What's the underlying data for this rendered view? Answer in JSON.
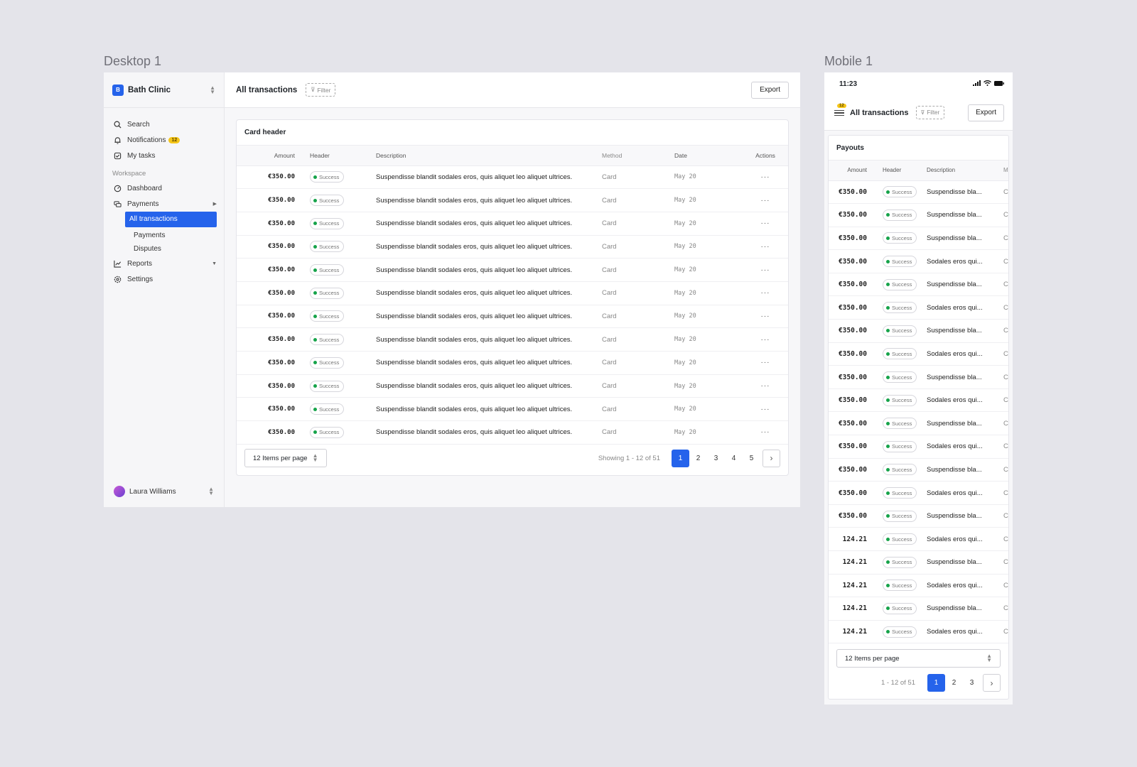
{
  "frames": {
    "desktop_label": "Desktop 1",
    "mobile_label": "Mobile 1"
  },
  "sidebar": {
    "org": {
      "logo_letter": "B",
      "name": "Bath Clinic"
    },
    "top_items": [
      {
        "label": "Search",
        "icon": "search-icon"
      },
      {
        "label": "Notifications",
        "icon": "bell-icon",
        "badge": "12"
      },
      {
        "label": "My tasks",
        "icon": "tasks-icon"
      }
    ],
    "workspace_title": "Workspace",
    "items": [
      {
        "label": "Dashboard",
        "icon": "dashboard-icon"
      },
      {
        "label": "Payments",
        "icon": "payments-icon",
        "arrow": "▶"
      }
    ],
    "payments_sub": [
      {
        "label": "All transactions",
        "active": true
      },
      {
        "label": "Payments",
        "active": false
      },
      {
        "label": "Disputes",
        "active": false
      }
    ],
    "bottom_items": [
      {
        "label": "Reports",
        "icon": "reports-icon",
        "arrow": "▼"
      },
      {
        "label": "Settings",
        "icon": "settings-icon"
      }
    ],
    "user": {
      "name": "Laura Williams"
    }
  },
  "desktop": {
    "title": "All transactions",
    "filter_label": "Filter",
    "export_label": "Export",
    "card_title": "Card header",
    "columns": [
      "Amount",
      "Header",
      "Description",
      "Method",
      "Date",
      "Actions"
    ],
    "rows": [
      {
        "amount": "€350.00",
        "status": "Success",
        "description": "Suspendisse blandit sodales eros, quis aliquet leo aliquet ultrices.",
        "method": "Card",
        "date": "May 20"
      },
      {
        "amount": "€350.00",
        "status": "Success",
        "description": "Suspendisse blandit sodales eros, quis aliquet leo aliquet ultrices.",
        "method": "Card",
        "date": "May 20"
      },
      {
        "amount": "€350.00",
        "status": "Success",
        "description": "Suspendisse blandit sodales eros, quis aliquet leo aliquet ultrices.",
        "method": "Card",
        "date": "May 20"
      },
      {
        "amount": "€350.00",
        "status": "Success",
        "description": "Suspendisse blandit sodales eros, quis aliquet leo aliquet ultrices.",
        "method": "Card",
        "date": "May 20"
      },
      {
        "amount": "€350.00",
        "status": "Success",
        "description": "Suspendisse blandit sodales eros, quis aliquet leo aliquet ultrices.",
        "method": "Card",
        "date": "May 20"
      },
      {
        "amount": "€350.00",
        "status": "Success",
        "description": "Suspendisse blandit sodales eros, quis aliquet leo aliquet ultrices.",
        "method": "Card",
        "date": "May 20"
      },
      {
        "amount": "€350.00",
        "status": "Success",
        "description": "Suspendisse blandit sodales eros, quis aliquet leo aliquet ultrices.",
        "method": "Card",
        "date": "May 20"
      },
      {
        "amount": "€350.00",
        "status": "Success",
        "description": "Suspendisse blandit sodales eros, quis aliquet leo aliquet ultrices.",
        "method": "Card",
        "date": "May 20"
      },
      {
        "amount": "€350.00",
        "status": "Success",
        "description": "Suspendisse blandit sodales eros, quis aliquet leo aliquet ultrices.",
        "method": "Card",
        "date": "May 20"
      },
      {
        "amount": "€350.00",
        "status": "Success",
        "description": "Suspendisse blandit sodales eros, quis aliquet leo aliquet ultrices.",
        "method": "Card",
        "date": "May 20"
      },
      {
        "amount": "€350.00",
        "status": "Success",
        "description": "Suspendisse blandit sodales eros, quis aliquet leo aliquet ultrices.",
        "method": "Card",
        "date": "May 20"
      },
      {
        "amount": "€350.00",
        "status": "Success",
        "description": "Suspendisse blandit sodales eros, quis aliquet leo aliquet ultrices.",
        "method": "Card",
        "date": "May 20"
      }
    ],
    "actions_glyph": "···",
    "pagination": {
      "items_per_page": "12 Items per page",
      "showing": "Showing 1 - 12 of 51",
      "pages": [
        "1",
        "2",
        "3",
        "4",
        "5"
      ],
      "current": "1",
      "next_glyph": "›"
    }
  },
  "mobile": {
    "time": "11:23",
    "menu_badge": "12",
    "title": "All transactions",
    "filter_label": "Filter",
    "export_label": "Export",
    "card_title": "Payouts",
    "columns": [
      "Amount",
      "Header",
      "Description",
      "M"
    ],
    "rows": [
      {
        "amount": "€350.00",
        "status": "Success",
        "description": "Suspendisse bla...",
        "method": "C"
      },
      {
        "amount": "€350.00",
        "status": "Success",
        "description": "Suspendisse bla...",
        "method": "C"
      },
      {
        "amount": "€350.00",
        "status": "Success",
        "description": "Suspendisse bla...",
        "method": "C"
      },
      {
        "amount": "€350.00",
        "status": "Success",
        "description": "Sodales eros qui...",
        "method": "C"
      },
      {
        "amount": "€350.00",
        "status": "Success",
        "description": "Suspendisse bla...",
        "method": "C"
      },
      {
        "amount": "€350.00",
        "status": "Success",
        "description": "Sodales eros qui...",
        "method": "C"
      },
      {
        "amount": "€350.00",
        "status": "Success",
        "description": "Suspendisse bla...",
        "method": "C"
      },
      {
        "amount": "€350.00",
        "status": "Success",
        "description": "Sodales eros qui...",
        "method": "C"
      },
      {
        "amount": "€350.00",
        "status": "Success",
        "description": "Suspendisse bla...",
        "method": "C"
      },
      {
        "amount": "€350.00",
        "status": "Success",
        "description": "Sodales eros qui...",
        "method": "C"
      },
      {
        "amount": "€350.00",
        "status": "Success",
        "description": "Suspendisse bla...",
        "method": "C"
      },
      {
        "amount": "€350.00",
        "status": "Success",
        "description": "Sodales eros qui...",
        "method": "C"
      },
      {
        "amount": "€350.00",
        "status": "Success",
        "description": "Suspendisse bla...",
        "method": "C"
      },
      {
        "amount": "€350.00",
        "status": "Success",
        "description": "Sodales eros qui...",
        "method": "C"
      },
      {
        "amount": "€350.00",
        "status": "Success",
        "description": "Suspendisse bla...",
        "method": "C"
      },
      {
        "amount": "124.21",
        "status": "Success",
        "description": "Sodales eros qui...",
        "method": "C"
      },
      {
        "amount": "124.21",
        "status": "Success",
        "description": "Suspendisse bla...",
        "method": "C"
      },
      {
        "amount": "124.21",
        "status": "Success",
        "description": "Sodales eros qui...",
        "method": "C"
      },
      {
        "amount": "124.21",
        "status": "Success",
        "description": "Suspendisse bla...",
        "method": "C"
      },
      {
        "amount": "124.21",
        "status": "Success",
        "description": "Sodales eros qui...",
        "method": "C"
      }
    ],
    "pagination": {
      "items_per_page": "12 Items per page",
      "showing": "1 - 12 of 51",
      "pages": [
        "1",
        "2",
        "3"
      ],
      "current": "1",
      "next_glyph": "›"
    }
  },
  "colors": {
    "accent": "#2563eb",
    "success": "#16a34a",
    "badge": "#f5c518",
    "canvas": "#e4e4ea"
  }
}
